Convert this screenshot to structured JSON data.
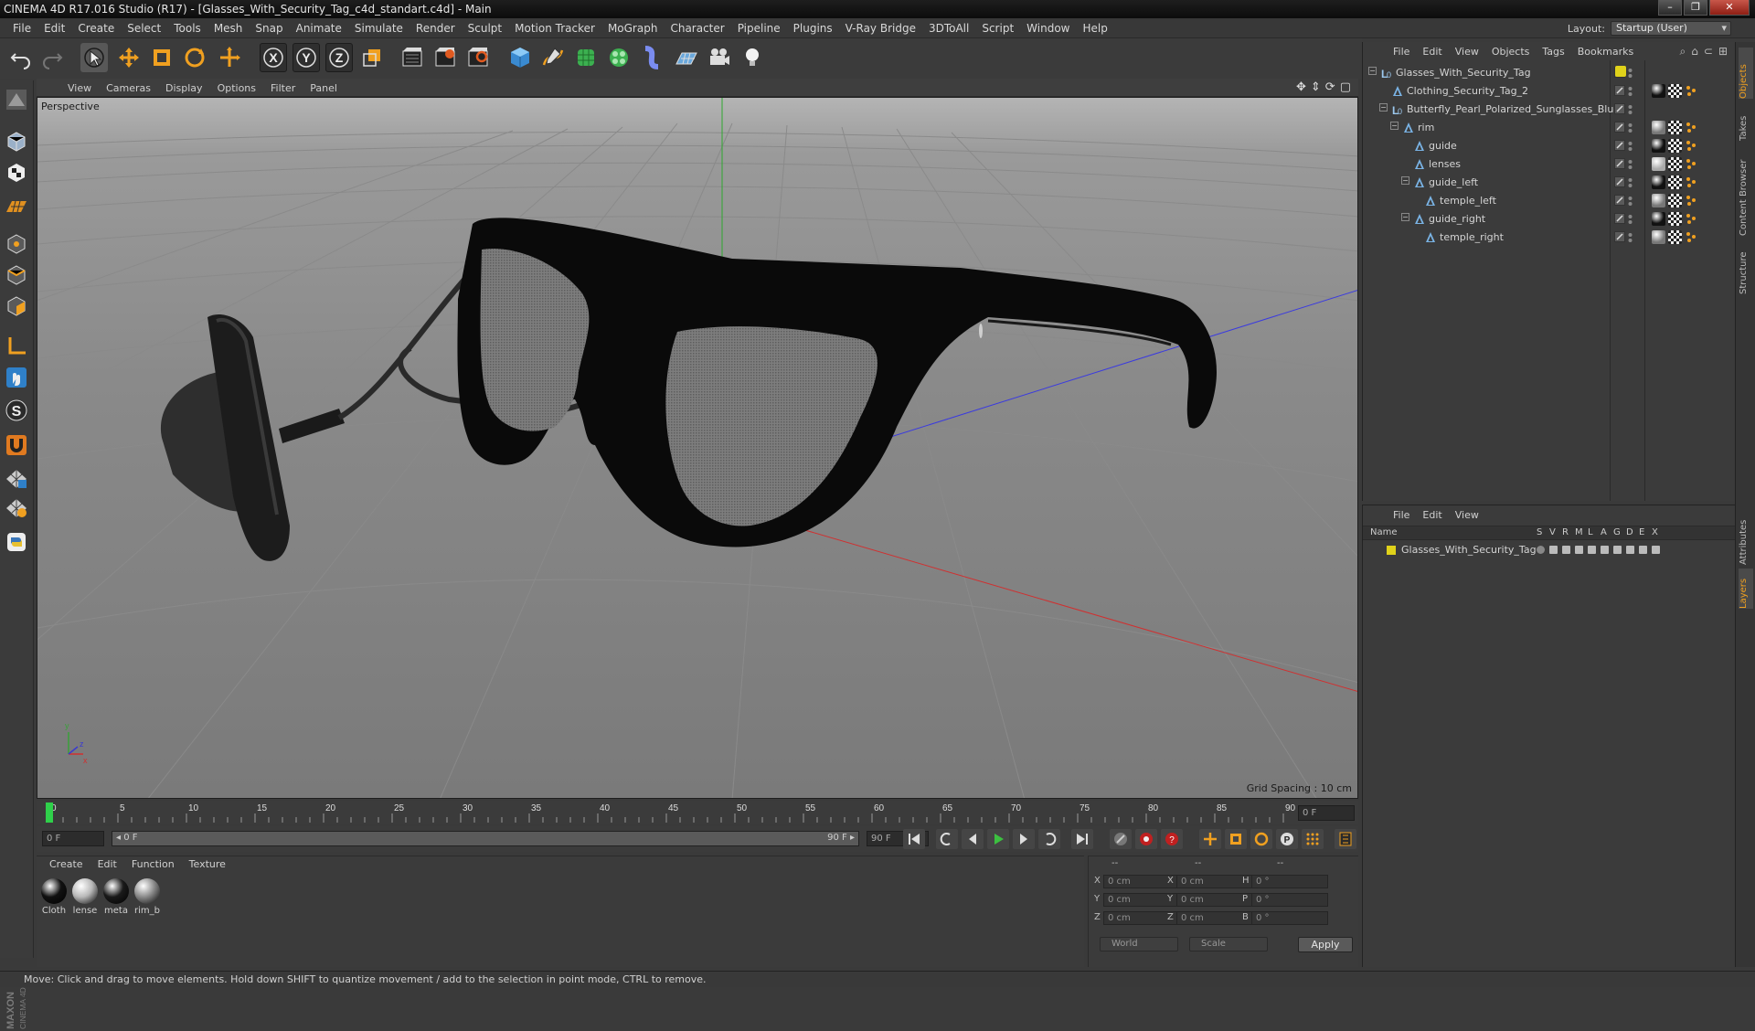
{
  "window": {
    "title": "CINEMA 4D R17.016 Studio (R17) - [Glasses_With_Security_Tag_c4d_standart.c4d] - Main",
    "buttons": [
      "–",
      "❐",
      "✕"
    ]
  },
  "menubar": {
    "items": [
      "File",
      "Edit",
      "Create",
      "Select",
      "Tools",
      "Mesh",
      "Snap",
      "Animate",
      "Simulate",
      "Render",
      "Sculpt",
      "Motion Tracker",
      "MoGraph",
      "Character",
      "Pipeline",
      "Plugins",
      "V-Ray Bridge",
      "3DToAll",
      "Script",
      "Window",
      "Help"
    ],
    "layout_label": "Layout:",
    "layout_value": "Startup (User)"
  },
  "toolbar": {
    "icons": [
      "undo-icon",
      "redo-icon",
      "live-selection-icon",
      "move-icon",
      "scale-icon",
      "rotate-icon",
      "last-tool-icon",
      "x-axis-icon",
      "y-axis-icon",
      "z-axis-icon",
      "coordinate-system-icon",
      "render-view-icon",
      "render-picture-viewer-icon",
      "edit-render-settings-icon",
      "cube-primitive-icon",
      "spline-pen-icon",
      "subdivision-icon",
      "cloner-icon",
      "deformer-icon",
      "floor-icon",
      "camera-icon",
      "light-icon"
    ],
    "axis_labels": [
      "X",
      "Y",
      "Z"
    ]
  },
  "lefttools": {
    "icons": [
      "sculpt-icon",
      "model-mode-icon",
      "texture-mode-icon",
      "workplane-icon",
      "points-mode-icon",
      "edges-mode-icon",
      "polygons-mode-icon",
      "axis-mode-icon",
      "tweak-mode-icon",
      "snap-icon",
      "magnet-icon",
      "grid-snap-icon",
      "soft-selection-icon",
      "python-icon"
    ]
  },
  "viewport": {
    "menu": [
      "View",
      "Cameras",
      "Display",
      "Options",
      "Filter",
      "Panel"
    ],
    "label": "Perspective",
    "grid_spacing": "Grid Spacing : 10 cm",
    "axis_y": "y",
    "axis_x": "x",
    "axis_z": "z"
  },
  "timeline": {
    "ticks": [
      "0",
      "5",
      "10",
      "15",
      "20",
      "25",
      "30",
      "35",
      "40",
      "45",
      "50",
      "55",
      "60",
      "65",
      "70",
      "75",
      "80",
      "85",
      "90"
    ],
    "current_frame": "0 F",
    "end_frame_field": "0 F"
  },
  "transport": {
    "start_field": "0 F",
    "range_start": "◂ 0 F",
    "range_end": "90 F ▸",
    "end_field": "90 F",
    "buttons": [
      "go-to-start-icon",
      "previous-keyframe-icon",
      "previous-frame-icon",
      "play-icon",
      "next-frame-icon",
      "next-keyframe-icon",
      "go-to-end-icon"
    ]
  },
  "material_manager": {
    "menu": [
      "Create",
      "Edit",
      "Function",
      "Texture"
    ],
    "materials": [
      {
        "name": "Cloth",
        "color": "#111111"
      },
      {
        "name": "lense",
        "color": "#b8b8b8"
      },
      {
        "name": "meta",
        "color": "#1a1a1a"
      },
      {
        "name": "rim_b",
        "color": "#8a8a8a"
      }
    ]
  },
  "coordinates": {
    "header_dashes": [
      "--",
      "--",
      "--"
    ],
    "rows": [
      {
        "a": "X",
        "av": "0 cm",
        "b": "X",
        "bv": "0 cm",
        "c": "H",
        "cv": "0 °"
      },
      {
        "a": "Y",
        "av": "0 cm",
        "b": "Y",
        "bv": "0 cm",
        "c": "P",
        "cv": "0 °"
      },
      {
        "a": "Z",
        "av": "0 cm",
        "b": "Z",
        "bv": "0 cm",
        "c": "B",
        "cv": "0 °"
      }
    ],
    "space": "World",
    "mode": "Scale",
    "apply": "Apply"
  },
  "objects_panel": {
    "menu": [
      "File",
      "Edit",
      "View",
      "Objects",
      "Tags",
      "Bookmarks"
    ],
    "rows": [
      {
        "name": "Glasses_With_Security_Tag",
        "type": "null",
        "indent": 0
      },
      {
        "name": "Clothing_Security_Tag_2",
        "type": "mesh",
        "indent": 1
      },
      {
        "name": "Butterfly_Pearl_Polarized_Sunglasses_Blue",
        "type": "null",
        "indent": 1
      },
      {
        "name": "rim",
        "type": "mesh",
        "indent": 2
      },
      {
        "name": "guide",
        "type": "mesh",
        "indent": 3
      },
      {
        "name": "lenses",
        "type": "mesh",
        "indent": 3
      },
      {
        "name": "guide_left",
        "type": "mesh",
        "indent": 3
      },
      {
        "name": "temple_left",
        "type": "mesh",
        "indent": 4
      },
      {
        "name": "guide_right",
        "type": "mesh",
        "indent": 3
      },
      {
        "name": "temple_right",
        "type": "mesh",
        "indent": 4
      }
    ]
  },
  "layers_panel": {
    "menu": [
      "File",
      "Edit",
      "View"
    ],
    "columns": [
      "Name",
      "S",
      "V",
      "R",
      "M",
      "L",
      "A",
      "G",
      "D",
      "E",
      "X"
    ],
    "layers": [
      {
        "name": "Glasses_With_Security_Tag",
        "color": "#e0d21a"
      }
    ]
  },
  "right_tabs": [
    "Objects",
    "Takes",
    "Content Browser",
    "Structure",
    "Attributes",
    "Layers"
  ],
  "status": "Move: Click and drag to move elements. Hold down SHIFT to quantize movement / add to the selection in point mode, CTRL to remove.",
  "brand": "MAXON CINEMA 4D"
}
